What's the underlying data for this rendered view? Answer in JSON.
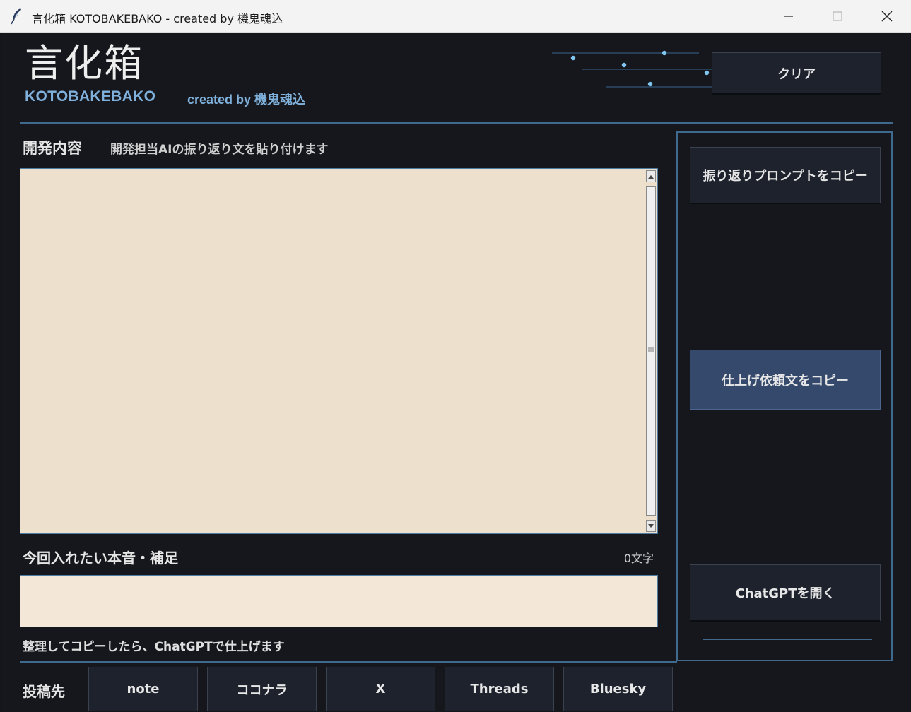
{
  "window": {
    "title": "言化箱 KOTOBAKEBAKO - created by 機鬼魂込",
    "controls": [
      "minimize-icon",
      "maximize-icon",
      "close-icon"
    ]
  },
  "header": {
    "logo": "言化箱",
    "logo_sub": "KOTOBAKEBAKO",
    "credit": "created by 機鬼魂込",
    "clear_label": "クリア"
  },
  "dev": {
    "title": "開発内容",
    "description": "開発担当AIの振り返り文を貼り付けます",
    "value": ""
  },
  "note": {
    "title": "今回入れたい本音・補足",
    "char_count": "0文字",
    "value": ""
  },
  "hint": "整理してコピーしたら、ChatGPTで仕上げます",
  "post": {
    "label": "投稿先",
    "targets": [
      "note",
      "ココナラ",
      "X",
      "Threads",
      "Bluesky"
    ]
  },
  "side": {
    "reflect_copy": "振り返りプロンプトをコピー",
    "finish_copy": "仕上げ依頼文をコピー",
    "open_chatgpt": "ChatGPTを開く"
  },
  "colors": {
    "background": "#16171c",
    "accent": "#3f6a8e",
    "accent_text": "#7fb1dc",
    "button": "#1d222d",
    "button_active": "#34496c",
    "textarea": "#ede0cc"
  }
}
